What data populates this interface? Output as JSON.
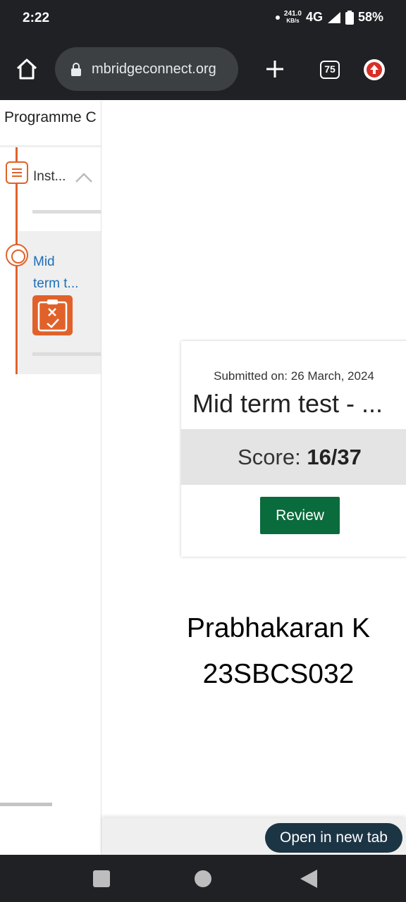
{
  "status": {
    "time": "2:22",
    "net_speed": "241.0",
    "net_unit": "KB/s",
    "network": "4G",
    "battery": "58%"
  },
  "browser": {
    "url": "mbridgeconnect.org",
    "tab_count": "75",
    "icons": [
      "home-icon",
      "lock-icon",
      "plus-icon",
      "tabs-icon",
      "update-icon"
    ]
  },
  "sidebar": {
    "title": "Programme C",
    "items": [
      {
        "label": "Inst...",
        "icon": "document-list-icon",
        "expanded": true
      },
      {
        "label_line1": "Mid",
        "label_line2": "term t...",
        "icon": "circle-icon",
        "quiz_icon": "quiz-result-icon",
        "active": true
      }
    ]
  },
  "result_card": {
    "submitted": "Submitted on: 26 March, 2024",
    "title": "Mid term test - ...",
    "score_label": "Score:",
    "score_value": "16/37",
    "review_label": "Review"
  },
  "content": {
    "name": "Prabhakaran K",
    "roll_id": "23SBCS032"
  },
  "footer": {
    "open_new_tab": "Open in new tab"
  },
  "colors": {
    "accent_orange": "#e0622a",
    "link_blue": "#1c6fb8",
    "review_green": "#0a6b3c",
    "chrome_dark": "#202124"
  }
}
